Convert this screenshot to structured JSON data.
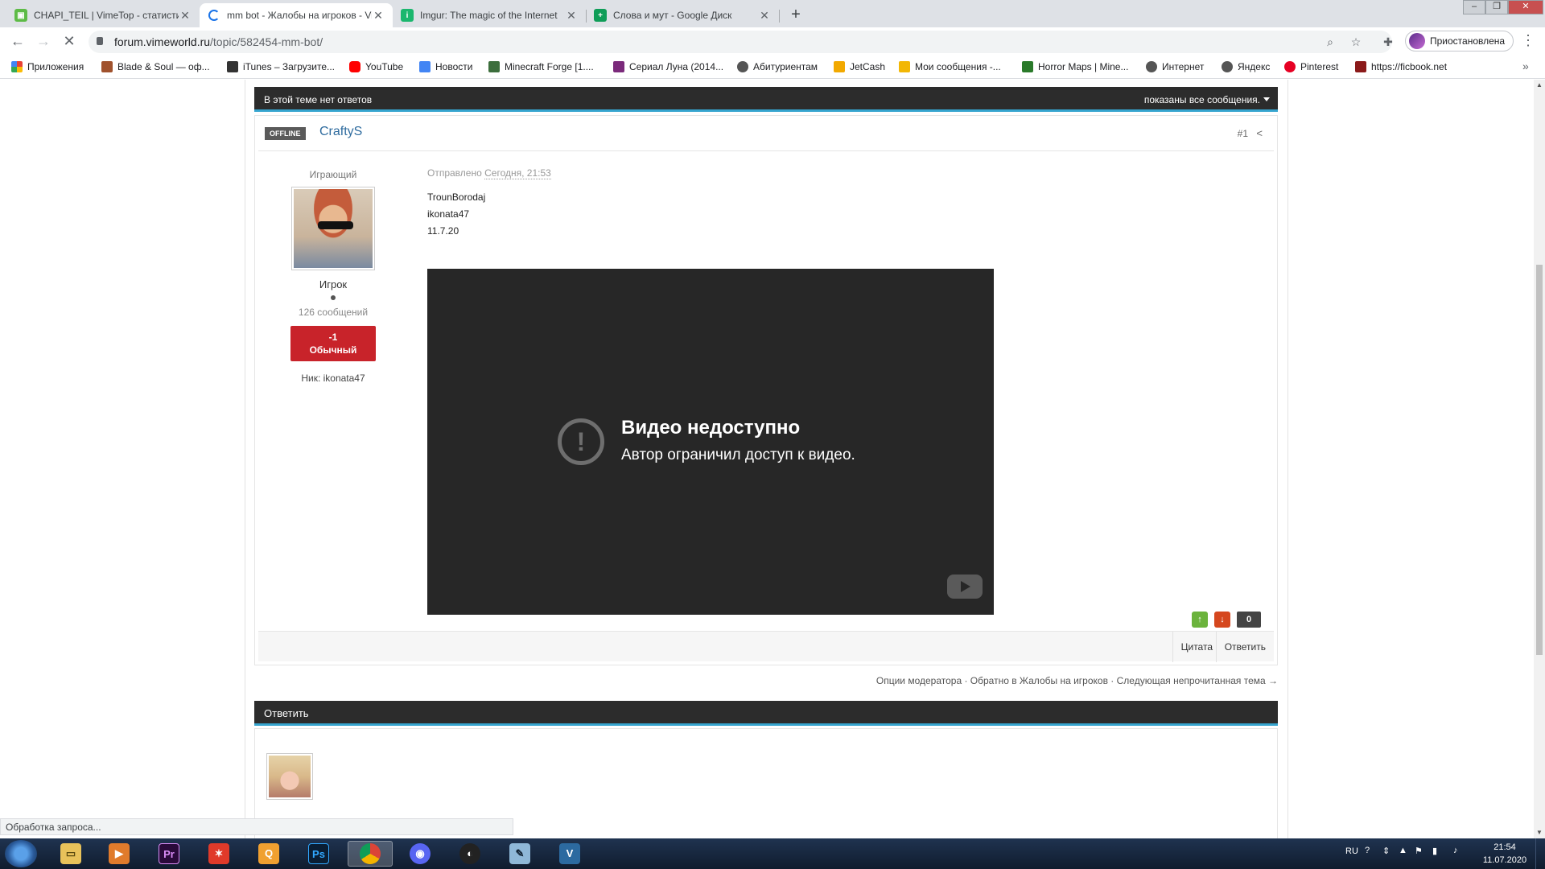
{
  "browser": {
    "tabs": [
      {
        "label": "CHAPI_TEIL | VimeTop - статистика",
        "icon": "vimetop-icon",
        "color": "#5dbb46"
      },
      {
        "label": "mm bot - Жалобы на игроков - VimeWorld",
        "icon": "loading-spinner-icon",
        "color": "#1a73e8"
      },
      {
        "label": "Imgur: The magic of the Internet",
        "icon": "imgur-icon",
        "color": "#1bb76e"
      },
      {
        "label": "Слова и мут - Google Диск",
        "icon": "google-sheets-icon",
        "color": "#0f9d58"
      }
    ],
    "url_host": "forum.vimeworld.ru",
    "url_path": "/topic/582454-mm-bot/",
    "profile_label": "Приостановлена",
    "bookmarks": [
      {
        "label": "Приложения",
        "color": "#e94235"
      },
      {
        "label": "Blade & Soul — оф...",
        "color": "#a0522d"
      },
      {
        "label": "iTunes – Загрузите...",
        "color": "#333333"
      },
      {
        "label": "YouTube",
        "color": "#ff0000"
      },
      {
        "label": "Новости",
        "color": "#4285f4"
      },
      {
        "label": "Minecraft Forge [1....",
        "color": "#3c6e3c"
      },
      {
        "label": "Сериал Луна (2014...",
        "color": "#7b2a7b"
      },
      {
        "label": "Абитуриентам",
        "color": "#555555"
      },
      {
        "label": "JetCash",
        "color": "#f2a900"
      },
      {
        "label": "Мои сообщения -...",
        "color": "#f2b705"
      },
      {
        "label": "Horror Maps | Mine...",
        "color": "#2a7a2a"
      },
      {
        "label": "Интернет",
        "color": "#555555"
      },
      {
        "label": "Яндекс",
        "color": "#555555"
      },
      {
        "label": "Pinterest",
        "color": "#e60023"
      },
      {
        "label": "https://ficbook.net",
        "color": "#8b1a1a"
      }
    ]
  },
  "forum": {
    "topic_bar_left": "В этой теме нет ответов",
    "topic_bar_right": "показаны все сообщения.",
    "post": {
      "status": "OFFLINE",
      "author": "CraftyS",
      "number": "#1",
      "user_title": "Играющий",
      "group": "Игрок",
      "post_count": "126 сообщений",
      "rep_value": "-1",
      "rep_label": "Обычный",
      "nick": "Ник: ikonata47",
      "posted_prefix": "Отправлено",
      "posted_date": "Сегодня, 21:53",
      "lines": [
        "TrounBorodaj",
        "ikonata47",
        "11.7.20"
      ],
      "video_title": "Видео недоступно",
      "video_subtitle": "Автор ограничил доступ к видео.",
      "vote_count": "0",
      "quote_label": "Цитата",
      "reply_label": "Ответить"
    },
    "mod_links": "Опции модератора · Обратно в Жалобы на игроков · Следующая непрочитанная тема →",
    "reply_header": "Ответить"
  },
  "status_bubble": "Обработка запроса...",
  "taskbar": {
    "lang": "RU",
    "time": "21:54",
    "date": "11.07.2020"
  },
  "colors": {
    "accent_blue": "#36a5cf",
    "bar_dark": "#2c2c2c",
    "rep_red": "#c8232a",
    "author_link": "#2e6b9e"
  }
}
